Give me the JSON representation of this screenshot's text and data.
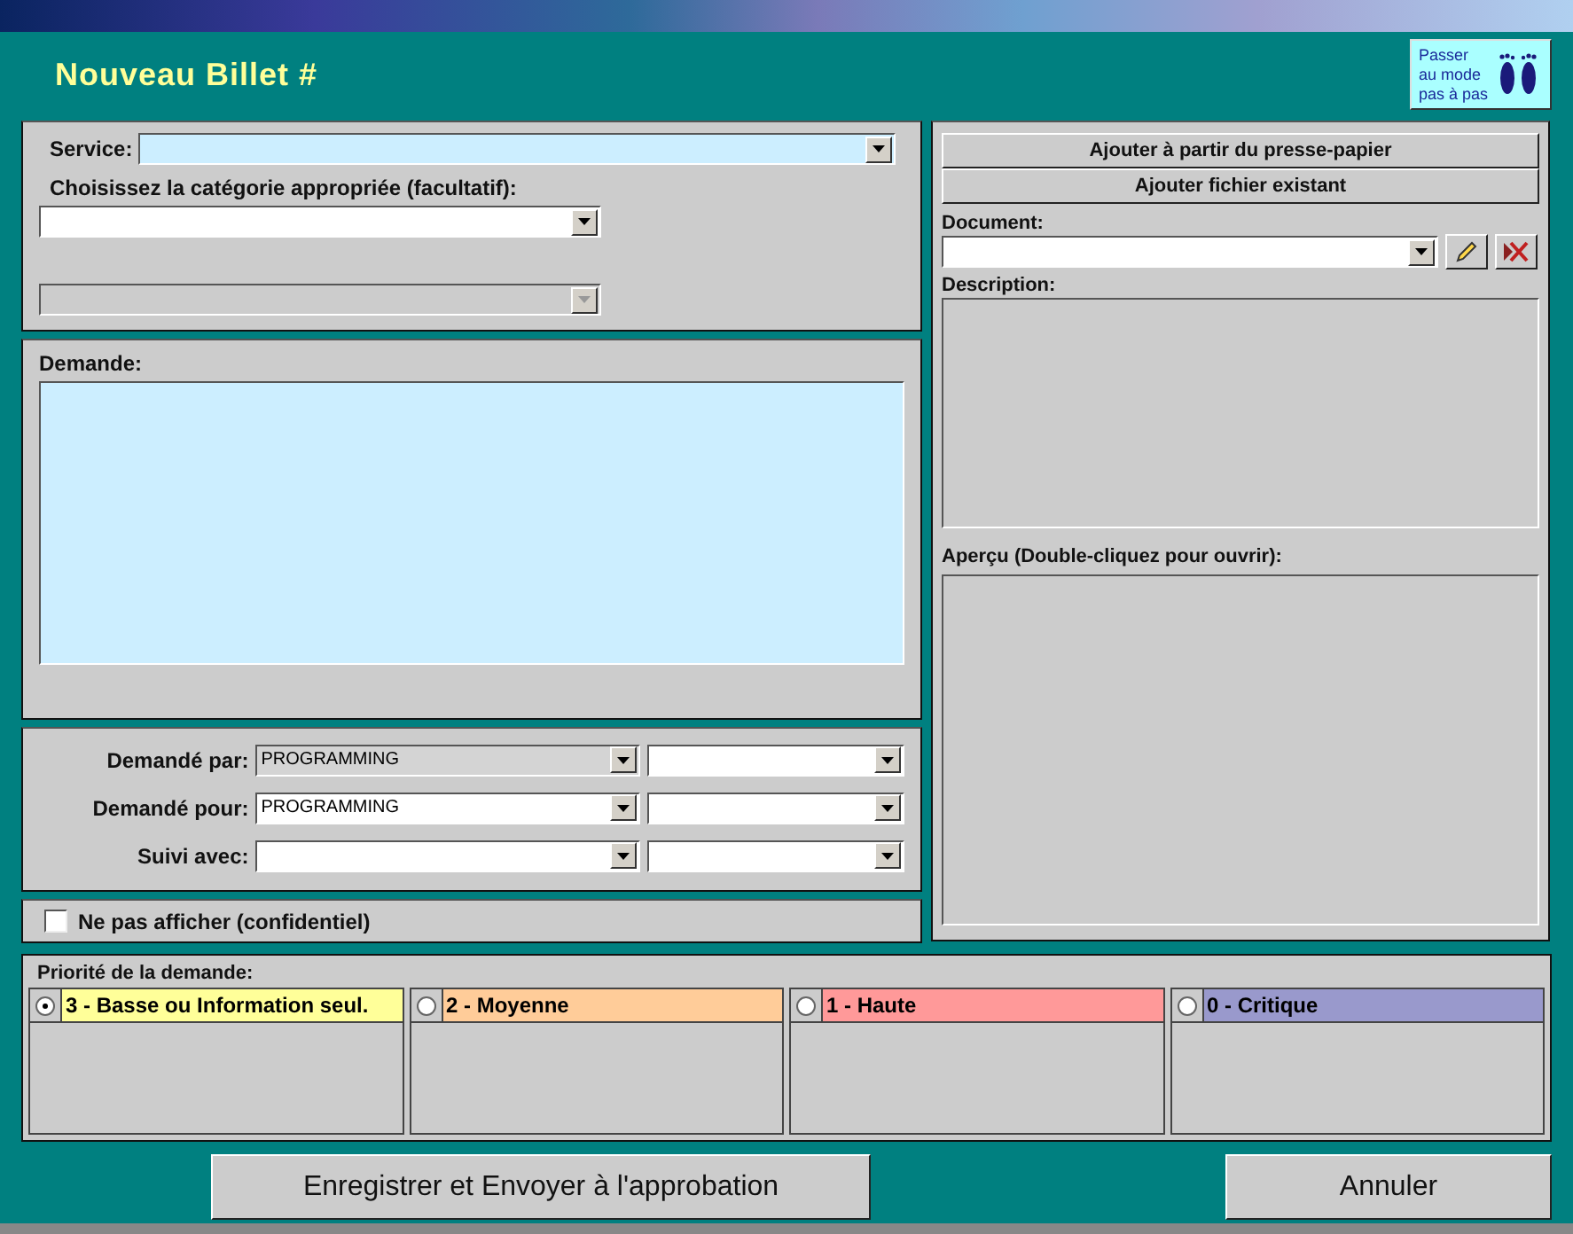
{
  "header": {
    "title": "Nouveau Billet #",
    "wizard_button": [
      "Passer",
      "au mode",
      "pas à pas"
    ]
  },
  "service": {
    "label": "Service:"
  },
  "category": {
    "label": "Choisissez la catégorie appropriée (facultatif):",
    "combos": [
      {
        "disabled": false
      },
      {
        "disabled": true
      }
    ]
  },
  "request": {
    "label": "Demande:"
  },
  "people": [
    {
      "label": "Demandé par:",
      "value": "PROGRAMMING",
      "disabled": true
    },
    {
      "label": "Demandé pour:",
      "value": "PROGRAMMING",
      "disabled": false
    },
    {
      "label": "Suivi avec:",
      "disabled": false
    }
  ],
  "confidential": {
    "label": "Ne pas afficher (confidentiel)",
    "checked": false
  },
  "attachments": {
    "buttons": [
      "Ajouter à partir du presse-papier",
      "Ajouter fichier existant"
    ],
    "document_label": "Document:",
    "description_label": "Description:",
    "preview_label": "Aperçu (Double-cliquez pour ouvrir):"
  },
  "priority": {
    "label": "Priorité de la demande:",
    "options": [
      {
        "label": "3 - Basse ou Information seul.",
        "color": "#ffff99",
        "selected": true
      },
      {
        "label": "2 - Moyenne",
        "color": "#ffcc99",
        "selected": false
      },
      {
        "label": "1 - Haute",
        "color": "#ff9999",
        "selected": false
      },
      {
        "label": "0 - Critique",
        "color": "#9999cc",
        "selected": false
      }
    ]
  },
  "actions": [
    {
      "label": "Enregistrer et Envoyer à l'approbation",
      "kind": "primary"
    },
    {
      "label": "Annuler",
      "kind": "cancel"
    }
  ]
}
